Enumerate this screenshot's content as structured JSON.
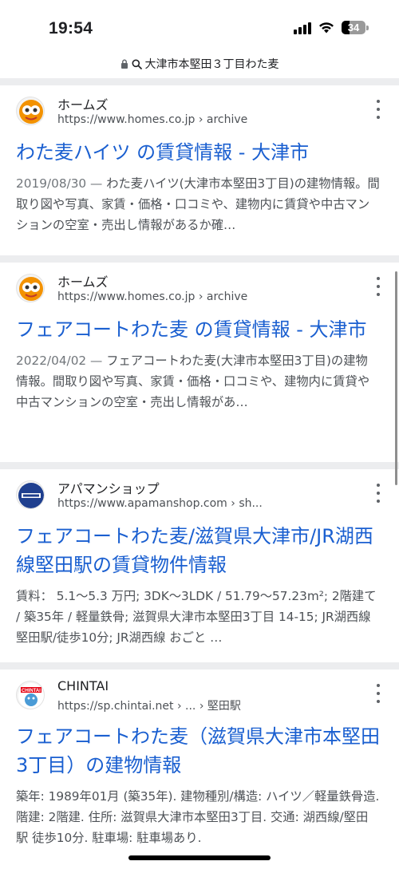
{
  "status_bar": {
    "time": "19:54",
    "battery": "34"
  },
  "url_bar": {
    "query": "大津市本堅田３丁目わた麦"
  },
  "results": [
    {
      "site_name": "ホームズ",
      "url": "https://www.homes.co.jp",
      "path": "› archive",
      "title": "わた麦ハイツ の賃貸情報 - 大津市",
      "date": "2019/08/30 —",
      "snippet": " わた麦ハイツ(大津市本堅田3丁目)の建物情報。間取り図や写真、家賃・価格・口コミや、建物内に賃貸や中古マンションの空室・売出し情報があるか確…",
      "favicon": "homes-icon"
    },
    {
      "site_name": "ホームズ",
      "url": "https://www.homes.co.jp",
      "path": "› archive",
      "title": "フェアコートわた麦 の賃貸情報 - 大津市",
      "date": "2022/04/02 —",
      "snippet": " フェアコートわた麦(大津市本堅田3丁目)の建物情報。間取り図や写真、家賃・価格・口コミや、建物内に賃貸や中古マンションの空室・売出し情報があ…",
      "favicon": "homes-icon"
    },
    {
      "site_name": "アパマンショップ",
      "url": "https://www.apamanshop.com",
      "path": "› sh...",
      "title": "フェアコートわた麦/滋賀県大津市/JR湖西線堅田駅の賃貸物件情報",
      "date": "",
      "snippet": "賃料： 5.1〜5.3 万円; 3DK〜3LDK / 51.79〜57.23m²; 2階建て / 築35年 / 軽量鉄骨; 滋賀県大津市本堅田3丁目 14-15; JR湖西線 堅田駅/徒歩10分; JR湖西線 おごと …",
      "favicon": "apamanshop-icon"
    },
    {
      "site_name": "CHINTAI",
      "url": "https://sp.chintai.net",
      "path": "› ... › 堅田駅",
      "title": "フェアコートわた麦（滋賀県大津市本堅田3丁目）の建物情報",
      "date": "",
      "snippet": "築年: 1989年01月 (築35年). 建物種別/構造: ハイツ／軽量鉄骨造. 階建: 2階建. 住所: 滋賀県大津市本堅田3丁目. 交通: 湖西線/堅田駅 徒歩10分. 駐車場: 駐車場あり.",
      "favicon": "chintai-icon"
    }
  ],
  "colors": {
    "link": "#1a5fd0",
    "snippet": "#4d5156",
    "feed_gap": "#ecedef"
  }
}
